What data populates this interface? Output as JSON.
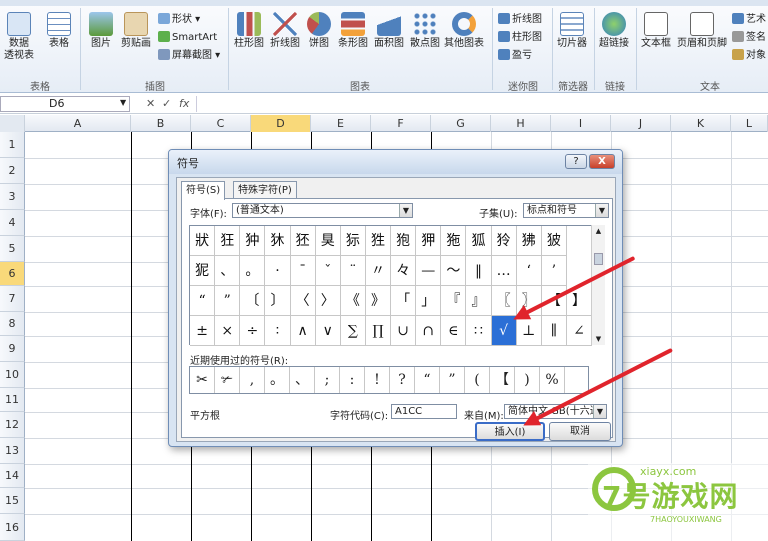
{
  "ribbon": {
    "groups": [
      {
        "label": "表格"
      },
      {
        "label": "插图"
      },
      {
        "label": "图表"
      },
      {
        "label": "迷你图"
      },
      {
        "label": "筛选器"
      },
      {
        "label": "链接"
      },
      {
        "label": "文本"
      }
    ],
    "buttons": {
      "pivot_line1": "数据",
      "pivot_line2": "透视表",
      "table": "表格",
      "picture": "图片",
      "clipart": "剪贴画",
      "shapes": "形状",
      "smartart": "SmartArt",
      "screenshot": "屏幕截图",
      "column": "柱形图",
      "line": "折线图",
      "pie": "饼图",
      "bar": "条形图",
      "area": "面积图",
      "scatter": "散点图",
      "other": "其他图表",
      "spark_line": "折线图",
      "spark_column": "柱形图",
      "spark_winloss": "盈亏",
      "slicer": "切片器",
      "hyperlink": "超链接",
      "textbox": "文本框",
      "header_footer": "页眉和页脚",
      "wordart": "艺术",
      "signature": "签名",
      "object": "对象"
    }
  },
  "formula_bar": {
    "name_box": "D6",
    "fx": "fx"
  },
  "columns": [
    "A",
    "B",
    "C",
    "D",
    "E",
    "F",
    "G",
    "H",
    "I",
    "J",
    "K",
    "L"
  ],
  "rows": [
    "1",
    "2",
    "3",
    "4",
    "5",
    "6",
    "7",
    "8",
    "9",
    "10",
    "11",
    "12",
    "13",
    "14",
    "15",
    "16"
  ],
  "dialog": {
    "title": "符号",
    "help": "?",
    "close": "X",
    "tabs": [
      "符号(S)",
      "特殊字符(P)"
    ],
    "font_label": "字体(F):",
    "font_value": "(普通文本)",
    "subset_label": "子集(U):",
    "subset_value": "标点和符号",
    "symbols": [
      [
        "狀",
        "狂",
        "狆",
        "狇",
        "狉",
        "狊",
        "狋",
        "狌",
        "狍",
        "狎",
        "狏",
        "狐",
        "狑",
        "狒",
        "狓"
      ],
      [
        "狔",
        "、",
        "。",
        "·",
        "ˉ",
        "ˇ",
        "¨",
        "〃",
        "々",
        "—",
        "～",
        "‖",
        "…",
        "‘",
        "’"
      ],
      [
        "“",
        "”",
        "〔",
        "〕",
        "〈",
        "〉",
        "《",
        "》",
        "「",
        "」",
        "『",
        "』",
        "〖",
        "〗",
        "【",
        "】"
      ],
      [
        "±",
        "×",
        "÷",
        "∶",
        "∧",
        "∨",
        "∑",
        "∏",
        "∪",
        "∩",
        "∈",
        "∷",
        "√",
        "⊥",
        "∥",
        "∠"
      ]
    ],
    "selected_symbol": "√",
    "recent_label": "近期使用过的符号(R):",
    "recent": [
      "✂",
      "✃",
      ",",
      "。",
      "、",
      ";",
      ":",
      "!",
      "?",
      "“",
      "”",
      "(",
      "【",
      ")",
      "%"
    ],
    "char_name": "平方根",
    "code_label": "字符代码(C):",
    "code_value": "A1CC",
    "from_label": "来自(M):",
    "from_value": "简体中文 GB(十六进制)",
    "insert": "插入(I)",
    "cancel": "取消"
  },
  "watermark": {
    "brand": "7号游戏网",
    "site": "xiayx.com",
    "pinyin": "7HAOYOUXIWANG"
  },
  "colors": {
    "selected": "#2b6fd6",
    "arrow": "#e0242c",
    "active_col": "#f9d97a"
  }
}
